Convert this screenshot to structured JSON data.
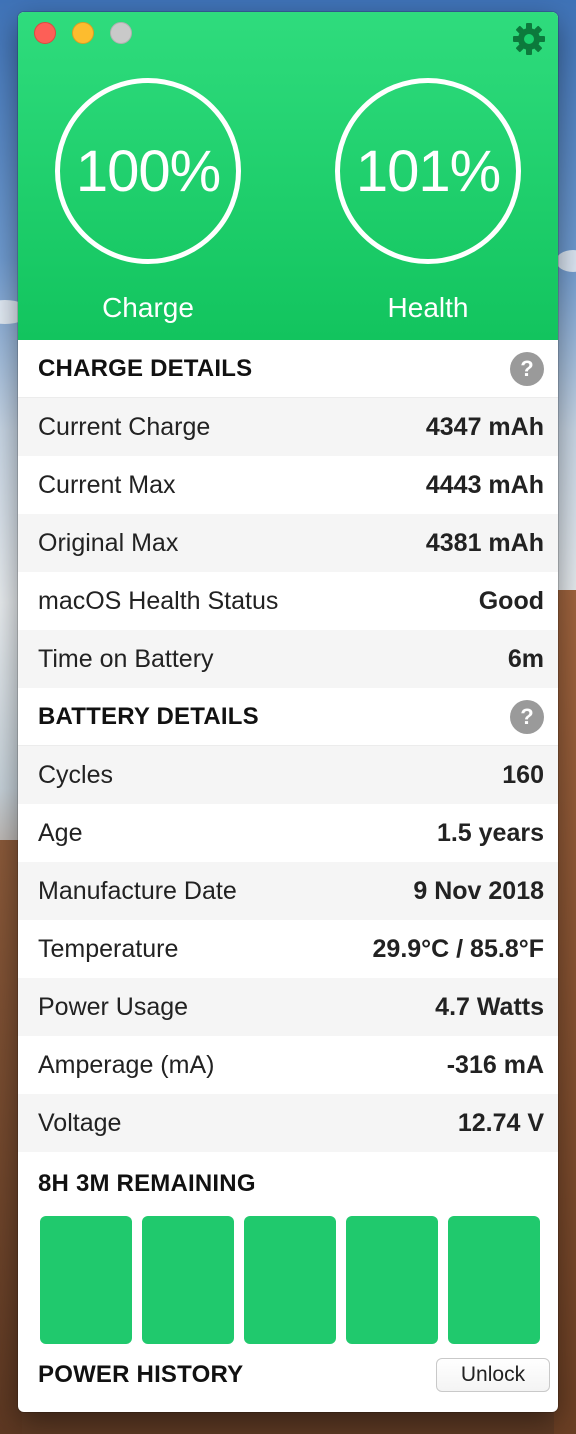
{
  "header": {
    "charge": {
      "value": "100%",
      "label": "Charge"
    },
    "health": {
      "value": "101%",
      "label": "Health"
    }
  },
  "charge_details": {
    "title": "CHARGE DETAILS",
    "help": "?",
    "rows": [
      {
        "label": "Current Charge",
        "value": "4347 mAh"
      },
      {
        "label": "Current Max",
        "value": "4443 mAh"
      },
      {
        "label": "Original Max",
        "value": "4381 mAh"
      },
      {
        "label": "macOS Health Status",
        "value": "Good"
      },
      {
        "label": "Time on Battery",
        "value": "6m"
      }
    ]
  },
  "battery_details": {
    "title": "BATTERY DETAILS",
    "help": "?",
    "rows": [
      {
        "label": "Cycles",
        "value": "160"
      },
      {
        "label": "Age",
        "value": "1.5 years"
      },
      {
        "label": "Manufacture Date",
        "value": "9 Nov 2018"
      },
      {
        "label": "Temperature",
        "value": "29.9°C / 85.8°F"
      },
      {
        "label": "Power Usage",
        "value": "4.7 Watts"
      },
      {
        "label": "Amperage (mA)",
        "value": "-316 mA"
      },
      {
        "label": "Voltage",
        "value": "12.74 V"
      }
    ]
  },
  "remaining": {
    "title": "8H 3M REMAINING",
    "bar_count": 5
  },
  "history": {
    "title": "POWER HISTORY",
    "unlock_label": "Unlock"
  },
  "colors": {
    "accent": "#1fcb6b",
    "header_top": "#2fdc7d",
    "header_bottom": "#12c45e",
    "gear": "#0c7a3c"
  },
  "icons": {
    "settings": "gear-icon",
    "help": "help-icon"
  }
}
